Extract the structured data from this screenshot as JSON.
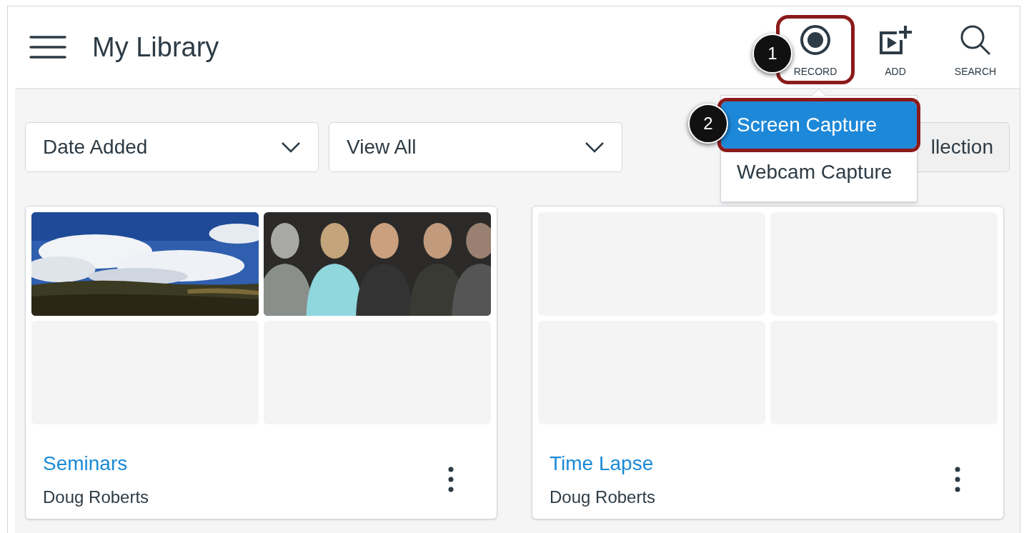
{
  "header": {
    "title": "My Library"
  },
  "toolbar": [
    {
      "kind": "record",
      "label": "RECORD",
      "highlighted": true
    },
    {
      "kind": "add",
      "label": "ADD",
      "highlighted": false
    },
    {
      "kind": "search",
      "label": "SEARCH",
      "highlighted": false
    }
  ],
  "filters": [
    {
      "value": "Date Added"
    },
    {
      "value": "View All"
    }
  ],
  "partial_button": {
    "label": "llection"
  },
  "record_menu": [
    {
      "label": "Screen Capture",
      "selected": true,
      "highlighted": true
    },
    {
      "label": "Webcam Capture",
      "selected": false,
      "highlighted": false
    }
  ],
  "callouts": [
    {
      "number": "1"
    },
    {
      "number": "2"
    }
  ],
  "collections": [
    {
      "title": "Seminars",
      "owner": "Doug Roberts",
      "thumbnails": [
        {
          "kind": "picture"
        },
        {
          "kind": "picture"
        },
        {
          "kind": "empty"
        },
        {
          "kind": "empty"
        }
      ]
    },
    {
      "title": "Time Lapse",
      "owner": "Doug Roberts",
      "thumbnails": [
        {
          "kind": "empty"
        },
        {
          "kind": "empty"
        },
        {
          "kind": "empty"
        },
        {
          "kind": "empty"
        }
      ]
    }
  ]
}
